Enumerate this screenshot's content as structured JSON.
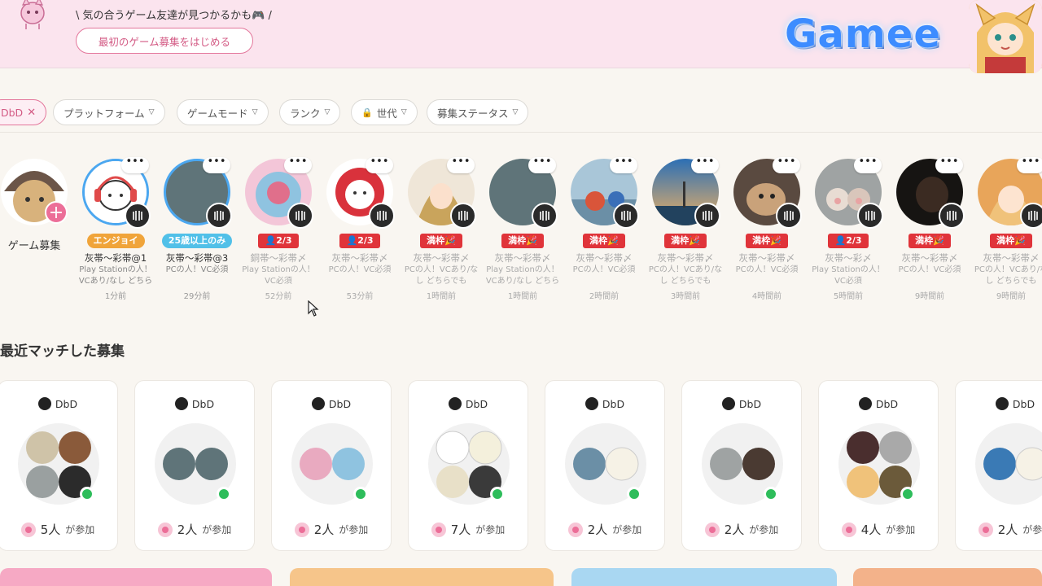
{
  "header": {
    "tagline": "\\ 気の合うゲーム友達が見つかるかも🎮 /",
    "start_button": "最初のゲーム募集をはじめる",
    "logo": "Gamee"
  },
  "filters": {
    "active_game": "DbD",
    "items": [
      "プラットフォーム",
      "ゲームモード",
      "ランク",
      "世代",
      "募集ステータス"
    ]
  },
  "recruitments": {
    "add_label": "ゲーム募集",
    "items": [
      {
        "tag": "エンジョイ",
        "name": "灰帯〜彩帯@1",
        "desc": "Play Stationの人！VCあり/なし どちらでも",
        "time": "1分前"
      },
      {
        "tag": "25歳以上のみ",
        "name": "灰帯〜彩帯@3",
        "desc": "PCの人！VC必須",
        "time": "29分前"
      },
      {
        "tag": "2/3",
        "name": "銅帯〜彩帯〆",
        "desc": "Play Stationの人！VC必須",
        "time": "52分前"
      },
      {
        "tag": "2/3",
        "name": "灰帯〜彩帯〆",
        "desc": "PCの人！VC必須",
        "time": "53分前"
      },
      {
        "tag": "満枠🎉",
        "name": "灰帯〜彩帯〆",
        "desc": "PCの人！VCあり/なし どちらでも",
        "time": "1時間前"
      },
      {
        "tag": "満枠🎉",
        "name": "灰帯〜彩帯〆",
        "desc": "Play Stationの人！VCあり/なし どちらでも",
        "time": "1時間前"
      },
      {
        "tag": "満枠🎉",
        "name": "灰帯〜彩帯〆",
        "desc": "PCの人！VC必須",
        "time": "2時間前"
      },
      {
        "tag": "満枠🎉",
        "name": "灰帯〜彩帯〆",
        "desc": "PCの人！VCあり/なし どちらでも",
        "time": "3時間前"
      },
      {
        "tag": "満枠🎉",
        "name": "灰帯〜彩帯〆",
        "desc": "PCの人！VC必須",
        "time": "4時間前"
      },
      {
        "tag": "2/3",
        "name": "灰帯〜彩〆",
        "desc": "Play Stationの人！VC必須",
        "time": "5時間前"
      },
      {
        "tag": "満枠🎉",
        "name": "灰帯〜彩帯〆",
        "desc": "PCの人！VC必須",
        "time": "9時間前"
      },
      {
        "tag": "満枠🎉",
        "name": "灰帯〜彩帯〆",
        "desc": "PCの人！VCあり/なし どちらでも",
        "time": "9時間前"
      }
    ]
  },
  "recent": {
    "title": "最近マッチした募集",
    "suffix": "が参加",
    "cards": [
      {
        "game": "DbD",
        "count": "5人"
      },
      {
        "game": "DbD",
        "count": "2人"
      },
      {
        "game": "DbD",
        "count": "2人"
      },
      {
        "game": "DbD",
        "count": "7人"
      },
      {
        "game": "DbD",
        "count": "2人"
      },
      {
        "game": "DbD",
        "count": "2人"
      },
      {
        "game": "DbD",
        "count": "4人"
      },
      {
        "game": "DbD",
        "count": "2人"
      }
    ]
  },
  "colors": {
    "accent_pink": "#e3769b",
    "header_bg": "#fbe4ee",
    "slot_red": "#e0343a",
    "online_green": "#2ebd5b"
  }
}
